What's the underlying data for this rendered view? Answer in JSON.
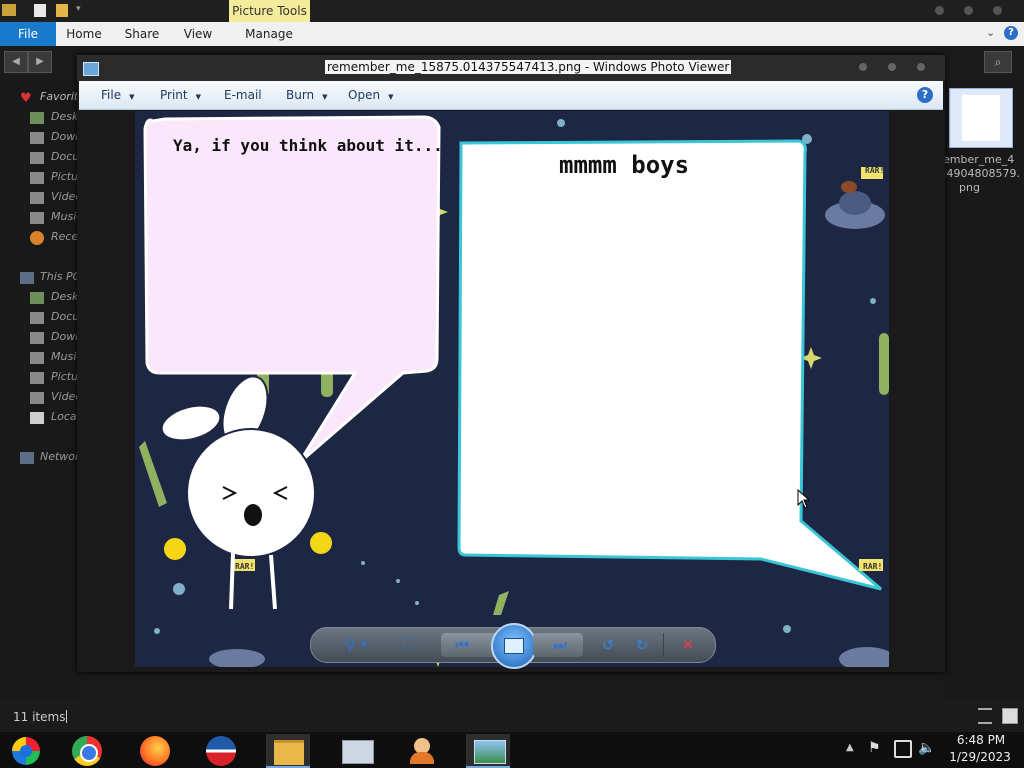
{
  "explorer": {
    "ribbon": {
      "tabs": [
        "File",
        "Home",
        "Share",
        "View",
        "Manage"
      ],
      "contextual_group": "Picture Tools"
    },
    "sidebar": {
      "items": [
        "Favorites",
        "Desktop",
        "Downloads",
        "Documents",
        "Pictures",
        "Videos",
        "Music",
        "Recent places",
        "This PC",
        "Desktop",
        "Documents",
        "Downloads",
        "Music",
        "Pictures",
        "Videos",
        "Local Disk",
        "Network"
      ],
      "visible_labels": [
        "Favorit",
        "Desk",
        "Down",
        "Docu",
        "Pictu",
        "Video",
        "Music",
        "Recen",
        "This PC",
        "Desk",
        "Docu",
        "Down",
        "Music",
        "Pictu",
        "Video",
        "Local",
        "Networ"
      ]
    },
    "right_file": {
      "name_line1": "ember_me_4",
      "name_line2": ".4904808579.",
      "name_line3": "png"
    },
    "status": {
      "items_count": "11 items"
    }
  },
  "viewer": {
    "title": "remember_me_15875.014375547413.png - Windows Photo Viewer",
    "menu": [
      "File",
      "Print",
      "E-mail",
      "Burn",
      "Open"
    ],
    "help": "?",
    "image": {
      "left_bubble_text": "Ya, if you think about it...",
      "right_bubble_text": "mmmm boys",
      "sign_text": "RAR!"
    },
    "controls": {
      "zoom": "zoom-icon",
      "fit": "fit-window-icon",
      "previous": "previous-icon",
      "slideshow": "slideshow-icon",
      "next": "next-icon",
      "rotate_ccw": "rotate-ccw-icon",
      "rotate_cw": "rotate-cw-icon",
      "delete": "delete-icon"
    }
  },
  "taskbar": {
    "apps": [
      "windows-media-player",
      "chrome",
      "firefox",
      "obama-app",
      "file-explorer",
      "performance-monitor",
      "user-app",
      "photo-viewer"
    ],
    "clock": {
      "time": "6:48 PM",
      "date": "1/29/2023"
    }
  },
  "colors": {
    "accent": "#1979ca",
    "left_bubble": "#fbe7fb",
    "right_bubble_border": "#39c6d6",
    "space": "#1d2744"
  }
}
